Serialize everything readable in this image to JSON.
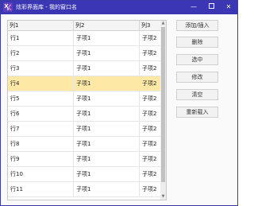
{
  "window": {
    "title": "炫彩界面库 - 我的窗口名",
    "minimize_glyph": "—",
    "close_glyph": "✕"
  },
  "app_icon": "xc-logo-icon",
  "colors": {
    "titlebar": "#3b37b4",
    "selected_row": "#fde9a5",
    "window_border": "#3a39a8"
  },
  "table": {
    "columns": [
      "列1",
      "列2",
      "列3"
    ],
    "rows": [
      [
        "行1",
        "子项1",
        "子项2"
      ],
      [
        "行2",
        "子项1",
        "子项2"
      ],
      [
        "行3",
        "子项1",
        "子项2"
      ],
      [
        "行4",
        "子项1",
        "子项2"
      ],
      [
        "行5",
        "子项1",
        "子项2"
      ],
      [
        "行6",
        "子项1",
        "子项2"
      ],
      [
        "行7",
        "子项1",
        "子项2"
      ],
      [
        "行8",
        "子项1",
        "子项2"
      ],
      [
        "行9",
        "子项1",
        "子项2"
      ],
      [
        "行10",
        "子项1",
        "子项2"
      ],
      [
        "行11",
        "子项1",
        "子项2"
      ]
    ],
    "selected_row": "行4"
  },
  "buttons": {
    "add": "添加/插入",
    "delete": "删除",
    "select": "选中",
    "modify": "修改",
    "clear": "清空",
    "reload": "重新载入"
  }
}
